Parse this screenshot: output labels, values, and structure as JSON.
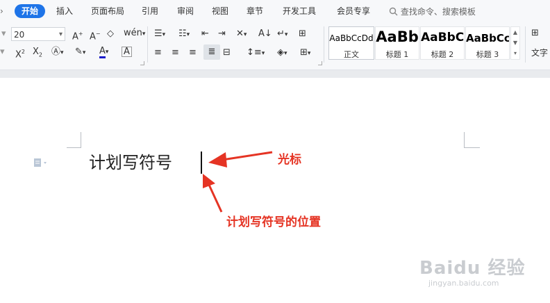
{
  "menubar": {
    "tabs": [
      "开始",
      "插入",
      "页面布局",
      "引用",
      "审阅",
      "视图",
      "章节",
      "开发工具",
      "会员专享"
    ],
    "search_placeholder": "查找命令、搜索模板"
  },
  "toolbar": {
    "font_size": "20"
  },
  "styles": [
    {
      "sample": "AaBbCcDd",
      "name": "正文"
    },
    {
      "sample": "AaBb",
      "name": "标题 1"
    },
    {
      "sample": "AaBbC",
      "name": "标题 2"
    },
    {
      "sample": "AaBbCc",
      "name": "标题 3"
    }
  ],
  "text_direction_label": "文字",
  "document": {
    "text": "计划写符号"
  },
  "annotations": {
    "cursor_label": "光标",
    "position_label": "计划写符号的位置"
  },
  "watermark": {
    "brand": "Baidu 经验",
    "url": "jingyan.baidu.com"
  },
  "colors": {
    "accent": "#1e74e8",
    "annotation": "#e53424"
  }
}
